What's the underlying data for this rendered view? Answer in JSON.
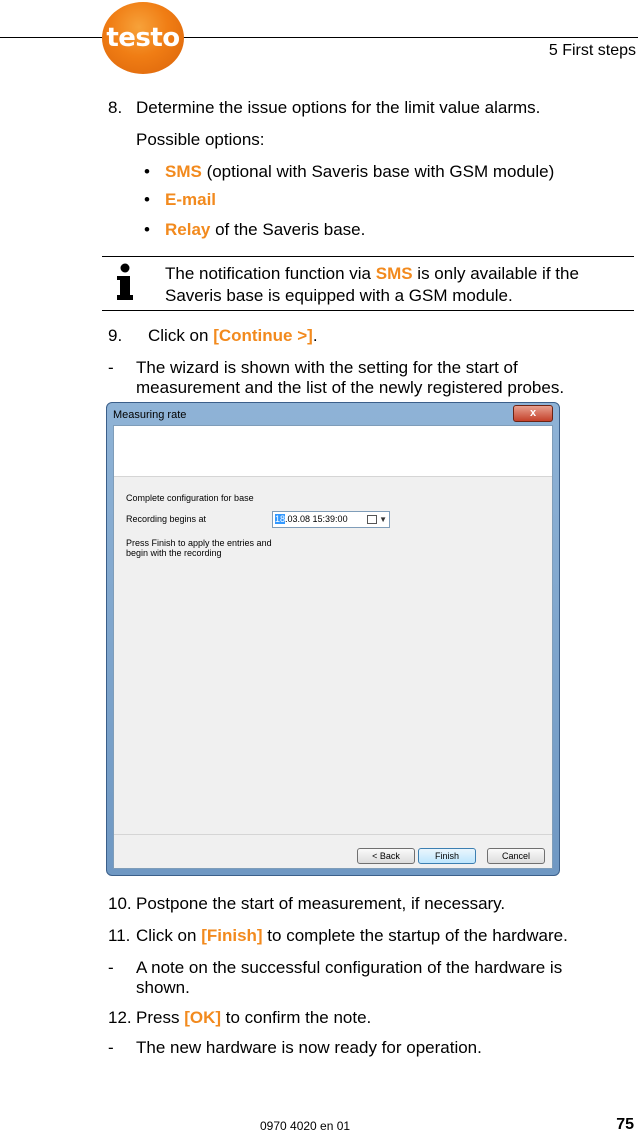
{
  "header": {
    "logo_text": "testo",
    "section": "5 First steps"
  },
  "step8": {
    "number": "8.",
    "text": "Determine the issue options for the limit value alarms.",
    "possible": "Possible options:",
    "options": [
      {
        "bullet": "•",
        "highlight": "SMS",
        "rest": " (optional with Saveris base with GSM module)"
      },
      {
        "bullet": "•",
        "highlight": "E-mail",
        "rest": ""
      },
      {
        "bullet": "•",
        "highlight": "Relay",
        "rest": " of the Saveris base."
      }
    ]
  },
  "info": {
    "line1_pre": "The notification function via ",
    "line1_hl": "SMS",
    "line1_post": " is only available if the",
    "line2": "Saveris base is equipped with a GSM module."
  },
  "step9": {
    "number": "9.",
    "pre": "Click on ",
    "hl": "[Continue >]",
    "post": "."
  },
  "result1": {
    "dash": "-",
    "line1": "The wizard is shown with the setting for the start of",
    "line2": "measurement and the list of the newly registered probes."
  },
  "dialog": {
    "title": "Measuring rate",
    "close": "x",
    "heading": "Complete configuration for base",
    "recording_label": "Recording begins at",
    "date_day": "18",
    "date_rest": ".03.08  15:39:00",
    "hint_line1": "Press Finish to apply the entries and",
    "hint_line2": "begin with the recording",
    "buttons": {
      "back": "< Back",
      "finish": "Finish",
      "cancel": "Cancel"
    }
  },
  "step10": {
    "number": "10.",
    "text": "Postpone the start of measurement, if necessary."
  },
  "step11": {
    "number": "11.",
    "pre": "Click on ",
    "hl": "[Finish]",
    "post": " to complete the startup of the hardware."
  },
  "result2": {
    "dash": "-",
    "line1": "A note on the successful configuration of the hardware is",
    "line2": "shown."
  },
  "step12": {
    "number": "12.",
    "pre": "Press ",
    "hl": "[OK]",
    "post": " to confirm the note."
  },
  "result3": {
    "dash": "-",
    "text": "The new hardware is now ready for operation."
  },
  "footer": {
    "doc_number": "0970 4020 en 01",
    "page": "75"
  }
}
